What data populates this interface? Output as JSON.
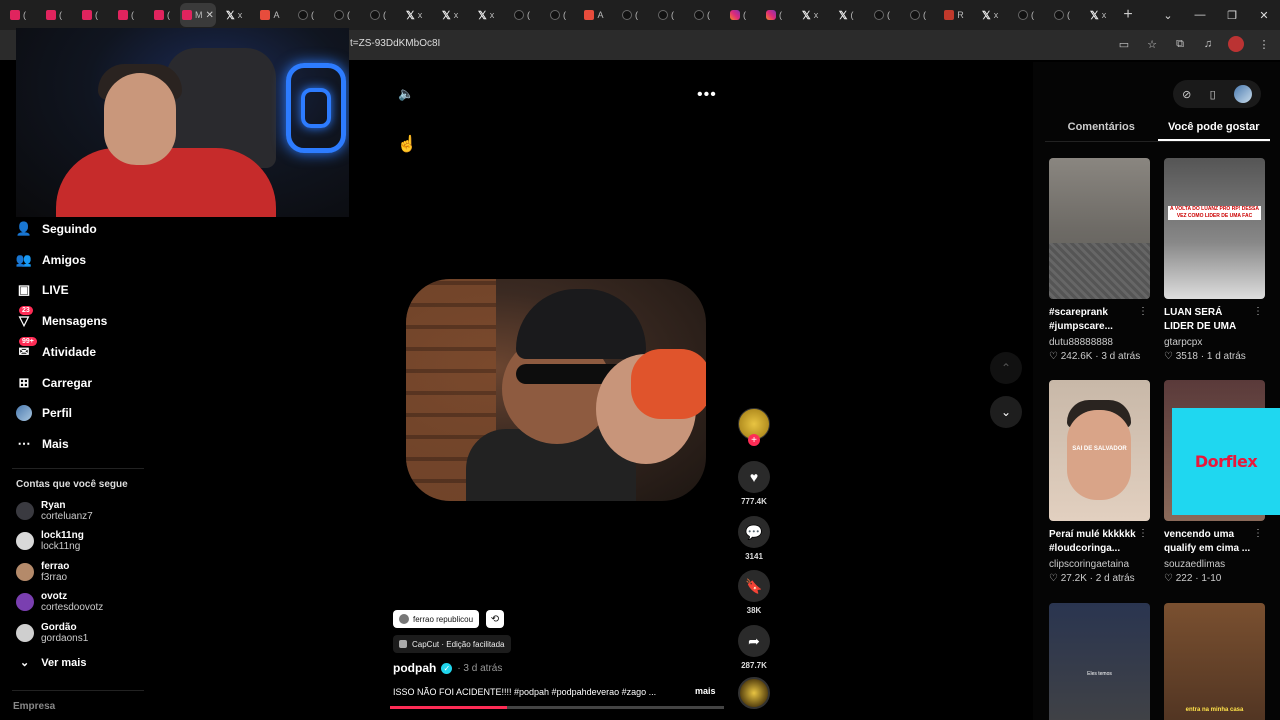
{
  "browser": {
    "tabs": [
      {
        "kind": "yt",
        "text": "("
      },
      {
        "kind": "yt",
        "text": "("
      },
      {
        "kind": "yt",
        "text": "("
      },
      {
        "kind": "yt",
        "text": "("
      },
      {
        "kind": "yt",
        "text": "("
      },
      {
        "kind": "yt",
        "text": "M",
        "active": true
      },
      {
        "kind": "x",
        "text": "x"
      },
      {
        "kind": "red",
        "text": "A"
      },
      {
        "kind": "tt",
        "text": "("
      },
      {
        "kind": "tt",
        "text": "("
      },
      {
        "kind": "tt",
        "text": "("
      },
      {
        "kind": "x",
        "text": "x"
      },
      {
        "kind": "x",
        "text": "x"
      },
      {
        "kind": "x",
        "text": "x"
      },
      {
        "kind": "tt",
        "text": "("
      },
      {
        "kind": "tt",
        "text": "("
      },
      {
        "kind": "red",
        "text": "A"
      },
      {
        "kind": "tt",
        "text": "("
      },
      {
        "kind": "tt",
        "text": "("
      },
      {
        "kind": "tt",
        "text": "("
      },
      {
        "kind": "ig",
        "text": "("
      },
      {
        "kind": "ig",
        "text": "("
      },
      {
        "kind": "x",
        "text": "x"
      },
      {
        "kind": "x",
        "text": "("
      },
      {
        "kind": "tt",
        "text": "("
      },
      {
        "kind": "tt",
        "text": "("
      },
      {
        "kind": "rd",
        "text": "R"
      },
      {
        "kind": "x",
        "text": "x"
      },
      {
        "kind": "tt",
        "text": "("
      },
      {
        "kind": "tt",
        "text": "("
      },
      {
        "kind": "x",
        "text": "x"
      }
    ],
    "new_tab": "+",
    "address_fragment": "t=ZS-93DdKMbOc8I",
    "window_controls": [
      "⌄",
      "—",
      "❐",
      "✕"
    ]
  },
  "nav": {
    "items": [
      {
        "label": "Seguindo",
        "icon": "following-icon"
      },
      {
        "label": "Amigos",
        "icon": "friends-icon"
      },
      {
        "label": "LIVE",
        "icon": "live-icon"
      },
      {
        "label": "Mensagens",
        "icon": "messages-icon",
        "badge": "23"
      },
      {
        "label": "Atividade",
        "icon": "activity-icon",
        "badge": "99+"
      },
      {
        "label": "Carregar",
        "icon": "upload-icon"
      },
      {
        "label": "Perfil",
        "icon": "profile-avatar"
      },
      {
        "label": "Mais",
        "icon": "more-icon"
      }
    ],
    "following_title": "Contas que você segue",
    "accounts": [
      {
        "name": "Ryan",
        "handle": "corteluanz7",
        "color": "#3a3a40"
      },
      {
        "name": "lock11ng",
        "handle": "lock11ng",
        "color": "#d9d9d9"
      },
      {
        "name": "ferrao",
        "handle": "f3rrao",
        "color": "#b48a6a"
      },
      {
        "name": "ovotz",
        "handle": "cortesdoovotz",
        "color": "#7a3fb0"
      },
      {
        "name": "Gordão",
        "handle": "gordaons1",
        "color": "#cfcfcf"
      }
    ],
    "see_more": "Ver mais",
    "company": "Empresa"
  },
  "video": {
    "reposted_by": "ferrao republicou",
    "capcut": "CapCut · Edição facilitada",
    "author": "podpah",
    "time": "· 3 d atrás",
    "caption": "ISSO NÃO FOI ACIDENTE!!!! #podpah #podpahdeverao #zago ...",
    "more": "mais",
    "progress": 0.35,
    "actions": [
      {
        "icon": "heart-icon",
        "glyph": "♥",
        "count": "777.4K"
      },
      {
        "icon": "comment-icon",
        "glyph": "💬",
        "count": "3141"
      },
      {
        "icon": "bookmark-icon",
        "glyph": "🔖",
        "count": "38K"
      },
      {
        "icon": "share-icon",
        "glyph": "➦",
        "count": "287.7K"
      }
    ]
  },
  "panel": {
    "tabs": [
      "Comentários",
      "Você pode gostar"
    ],
    "active_tab": 1,
    "cards": [
      {
        "title": "#scareprank #jumpscare...",
        "author": "dutu88888888",
        "stats": "♡ 242.6K · 3 d atrás",
        "thumb": "t1"
      },
      {
        "title": "LUAN SERÁ LIDER DE UMA FAC NO...",
        "author": "gtarpcpx",
        "stats": "♡ 3518 · 1 d atrás",
        "thumb": "t2",
        "thumb_text": "A VOLTA DO LUANZ PRO RP! DESSA VEZ COMO LIDER DE UMA FAC"
      },
      {
        "title": "Peraí mulé kkkkkk #loudcoringa...",
        "author": "clipscoringaetaina",
        "stats": "♡ 27.2K · 2 d atrás",
        "thumb": "t3",
        "thumb_text": "SAI DE SALVADOR"
      },
      {
        "title": "vencendo uma qualify em cima ...",
        "author": "souzaedlimas",
        "stats": "♡ 222 · 1-10",
        "thumb": "t4"
      },
      {
        "title": "",
        "author": "",
        "stats": "",
        "thumb": "t5",
        "thumb_text": "Eles temos"
      },
      {
        "title": "",
        "author": "",
        "stats": "",
        "thumb": "t6",
        "thumb_text": "entra na minha casa"
      }
    ],
    "ad_text": "Dorflex"
  }
}
